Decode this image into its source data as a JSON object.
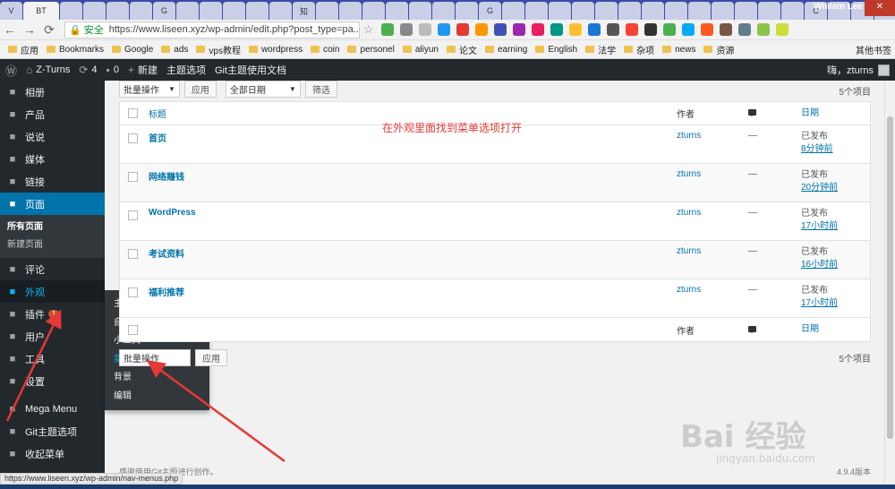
{
  "browser": {
    "tab_labels": [
      "V",
      "BT",
      "",
      "",
      "",
      "",
      "G",
      "",
      "",
      "",
      "",
      "",
      "知",
      "",
      "",
      "",
      "",
      "",
      "",
      "",
      "G",
      "",
      "",
      "",
      "",
      "",
      "",
      "",
      "",
      "",
      "",
      "",
      "",
      "",
      "C",
      "",
      "",
      "G",
      "",
      "",
      "",
      ""
    ],
    "active_tab_label": "BT",
    "user_name": "William Lee",
    "secure_label": "安全",
    "url": "https://www.liseen.xyz/wp-admin/edit.php?post_type=pa...",
    "bookmarks": [
      "应用",
      "Bookmarks",
      "Google",
      "ads",
      "vps教程",
      "wordpress",
      "coin",
      "personel",
      "aliyun",
      "论文",
      "earning",
      "English",
      "法学",
      "杂项",
      "news",
      "资源"
    ],
    "bookmarks_other": "其他书签"
  },
  "adminbar": {
    "wp_logo": "wordpress-icon",
    "site_name": "Z-Turns",
    "updates": "4",
    "comments": "0",
    "new_label": "新建",
    "theme_options": "主题选项",
    "git_docs": "Git主题使用文档",
    "greeting": "嗨，zturns"
  },
  "sidebar": {
    "items": [
      {
        "label": "相册",
        "icon": "gallery-icon"
      },
      {
        "label": "产品",
        "icon": "cart-icon"
      },
      {
        "label": "说说",
        "icon": "chat-icon"
      },
      {
        "label": "媒体",
        "icon": "media-icon"
      },
      {
        "label": "链接",
        "icon": "link-icon"
      },
      {
        "label": "页面",
        "icon": "page-icon"
      }
    ],
    "pages_sub": [
      "所有页面",
      "新建页面"
    ],
    "items2": [
      {
        "label": "评论",
        "icon": "comment-icon"
      },
      {
        "label": "外观",
        "icon": "brush-icon"
      },
      {
        "label": "插件",
        "icon": "plugin-icon",
        "badge": "1"
      },
      {
        "label": "用户",
        "icon": "user-icon"
      },
      {
        "label": "工具",
        "icon": "tool-icon"
      },
      {
        "label": "设置",
        "icon": "settings-icon"
      },
      {
        "label": "Mega Menu",
        "icon": "mega-menu-icon"
      },
      {
        "label": "Git主题选项",
        "icon": "gear-icon"
      },
      {
        "label": "收起菜单",
        "icon": "collapse-icon"
      }
    ]
  },
  "flyout": [
    "主题",
    "自定义",
    "小工具",
    "菜单",
    "背景",
    "编辑"
  ],
  "toolbar": {
    "bulk_action": "批量操作",
    "apply": "应用",
    "all_dates": "全部日期",
    "filter": "筛选",
    "item_count": "5个项目"
  },
  "table": {
    "headers": {
      "title": "标题",
      "author": "作者",
      "date": "日期"
    },
    "rows": [
      {
        "title": "首页",
        "author": "zturns",
        "comments": "—",
        "status": "已发布",
        "time": "8分钟前"
      },
      {
        "title": "网络赚钱",
        "author": "zturns",
        "comments": "—",
        "status": "已发布",
        "time": "20分钟前"
      },
      {
        "title": "WordPress",
        "author": "zturns",
        "comments": "—",
        "status": "已发布",
        "time": "17小时前"
      },
      {
        "title": "考试资料",
        "author": "zturns",
        "comments": "—",
        "status": "已发布",
        "time": "16小时前"
      },
      {
        "title": "福利推荐",
        "author": "zturns",
        "comments": "—",
        "status": "已发布",
        "time": "17小时前"
      }
    ]
  },
  "annotation": "在外观里面找到菜单选项打开",
  "footer": {
    "left": "感谢使用Git主题进行创作。",
    "version": "4.9.4版本"
  },
  "statusbar": "https://www.liseen.xyz/wp-admin/nav-menus.php",
  "watermark": {
    "main": "Bai 经验",
    "sub": "jingyan.baidu.com"
  },
  "colors": {
    "admin_dark": "#23282d",
    "wp_blue": "#0073aa",
    "highlight": "#00b9eb",
    "annotation_red": "#e53935"
  }
}
